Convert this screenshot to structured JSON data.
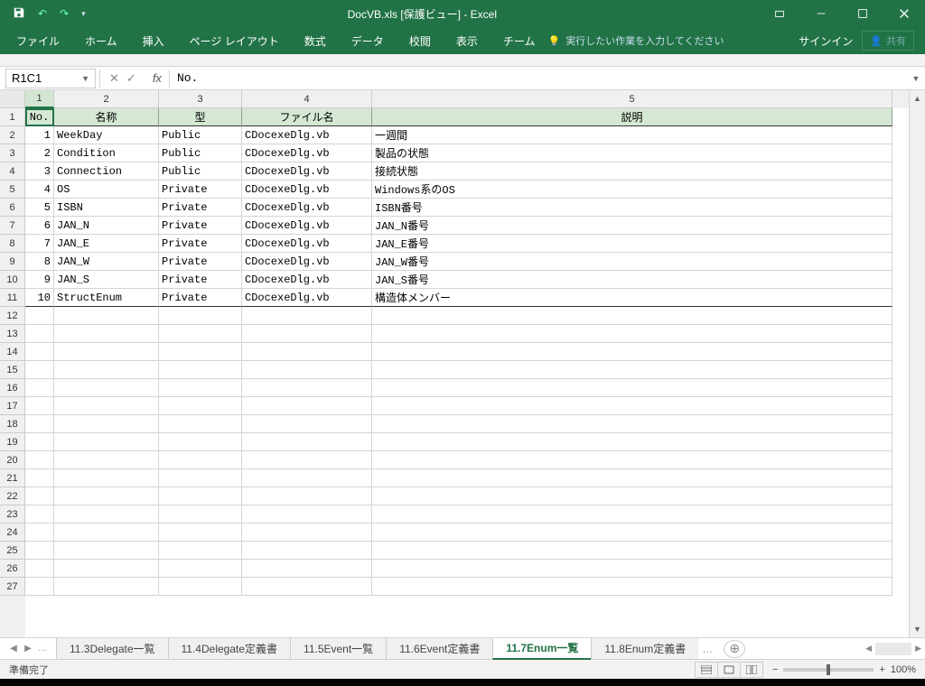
{
  "title": "DocVB.xls  [保護ビュー] - Excel",
  "ribbon": {
    "tabs": [
      "ファイル",
      "ホーム",
      "挿入",
      "ページ レイアウト",
      "数式",
      "データ",
      "校閲",
      "表示",
      "チーム"
    ],
    "tellme": "実行したい作業を入力してください",
    "signin": "サインイン",
    "share": "共有"
  },
  "namebox": "R1C1",
  "formula": "No.",
  "columns": [
    {
      "num": "1",
      "w": "col-no"
    },
    {
      "num": "2",
      "w": "col-name"
    },
    {
      "num": "3",
      "w": "col-type"
    },
    {
      "num": "4",
      "w": "col-file"
    },
    {
      "num": "5",
      "w": "col-desc"
    }
  ],
  "headers": {
    "no": "No.",
    "name": "名称",
    "type": "型",
    "file": "ファイル名",
    "desc": "説明"
  },
  "rows": [
    {
      "no": "1",
      "name": "WeekDay",
      "type": "Public",
      "file": "CDocexeDlg.vb",
      "desc": "一週間"
    },
    {
      "no": "2",
      "name": "Condition",
      "type": "Public",
      "file": "CDocexeDlg.vb",
      "desc": "製品の状態"
    },
    {
      "no": "3",
      "name": "Connection",
      "type": "Public",
      "file": "CDocexeDlg.vb",
      "desc": "接続状態"
    },
    {
      "no": "4",
      "name": "OS",
      "type": "Private",
      "file": "CDocexeDlg.vb",
      "desc": "Windows系のOS"
    },
    {
      "no": "5",
      "name": "ISBN",
      "type": "Private",
      "file": "CDocexeDlg.vb",
      "desc": "ISBN番号"
    },
    {
      "no": "6",
      "name": "JAN_N",
      "type": "Private",
      "file": "CDocexeDlg.vb",
      "desc": "JAN_N番号"
    },
    {
      "no": "7",
      "name": "JAN_E",
      "type": "Private",
      "file": "CDocexeDlg.vb",
      "desc": "JAN_E番号"
    },
    {
      "no": "8",
      "name": "JAN_W",
      "type": "Private",
      "file": "CDocexeDlg.vb",
      "desc": "JAN_W番号"
    },
    {
      "no": "9",
      "name": "JAN_S",
      "type": "Private",
      "file": "CDocexeDlg.vb",
      "desc": "JAN_S番号"
    },
    {
      "no": "10",
      "name": "StructEnum",
      "type": "Private",
      "file": "CDocexeDlg.vb",
      "desc": "構造体メンバー"
    }
  ],
  "emptyRows": 16,
  "sheettabs": [
    {
      "label": "11.3Delegate一覧",
      "active": false
    },
    {
      "label": "11.4Delegate定義書",
      "active": false
    },
    {
      "label": "11.5Event一覧",
      "active": false
    },
    {
      "label": "11.6Event定義書",
      "active": false
    },
    {
      "label": "11.7Enum一覧",
      "active": true
    },
    {
      "label": "11.8Enum定義書",
      "active": false
    }
  ],
  "status": {
    "ready": "準備完了",
    "zoom": "100%"
  }
}
